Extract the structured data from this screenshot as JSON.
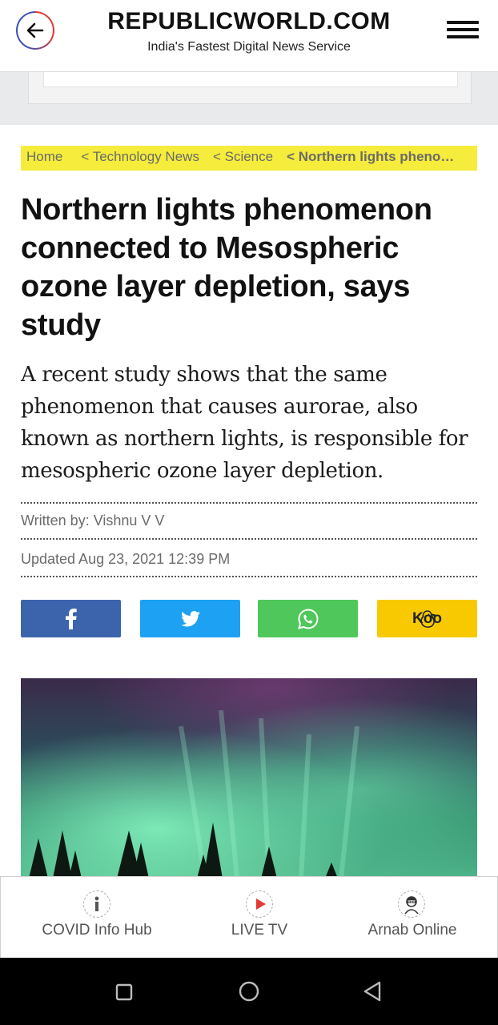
{
  "header": {
    "brand": "REPUBLICWORLD.COM",
    "tagline": "India's Fastest Digital News Service"
  },
  "breadcrumb": {
    "items": [
      "Home",
      "< Technology News",
      "< Science",
      "< Northern lights phenomenon connected to Mesospheric ozone layer depletion, says study"
    ]
  },
  "article": {
    "headline": "Northern lights phenomenon connected to Mesospheric ozone layer depletion, says study",
    "summary": "A recent study shows that the same phenomenon that causes aurorae, also known as northern lights, is responsible for mesospheric ozone layer depletion.",
    "author": "Written by: Vishnu V V",
    "updated": "Updated Aug 23, 2021 12:39 PM"
  },
  "share": {
    "koo_label": "Koo",
    "colors": {
      "facebook": "#3b64ad",
      "twitter": "#1da1f2",
      "whatsapp": "#4fc75a",
      "koo": "#f9c900"
    }
  },
  "bottom_nav": {
    "items": [
      {
        "label": "COVID Info Hub",
        "icon": "info-icon"
      },
      {
        "label": "LIVE TV",
        "icon": "play-icon"
      },
      {
        "label": "Arnab Online",
        "icon": "avatar-icon"
      }
    ]
  },
  "colors": {
    "breadcrumb_bg": "#f5ec3c",
    "accent_red": "#e53935"
  }
}
